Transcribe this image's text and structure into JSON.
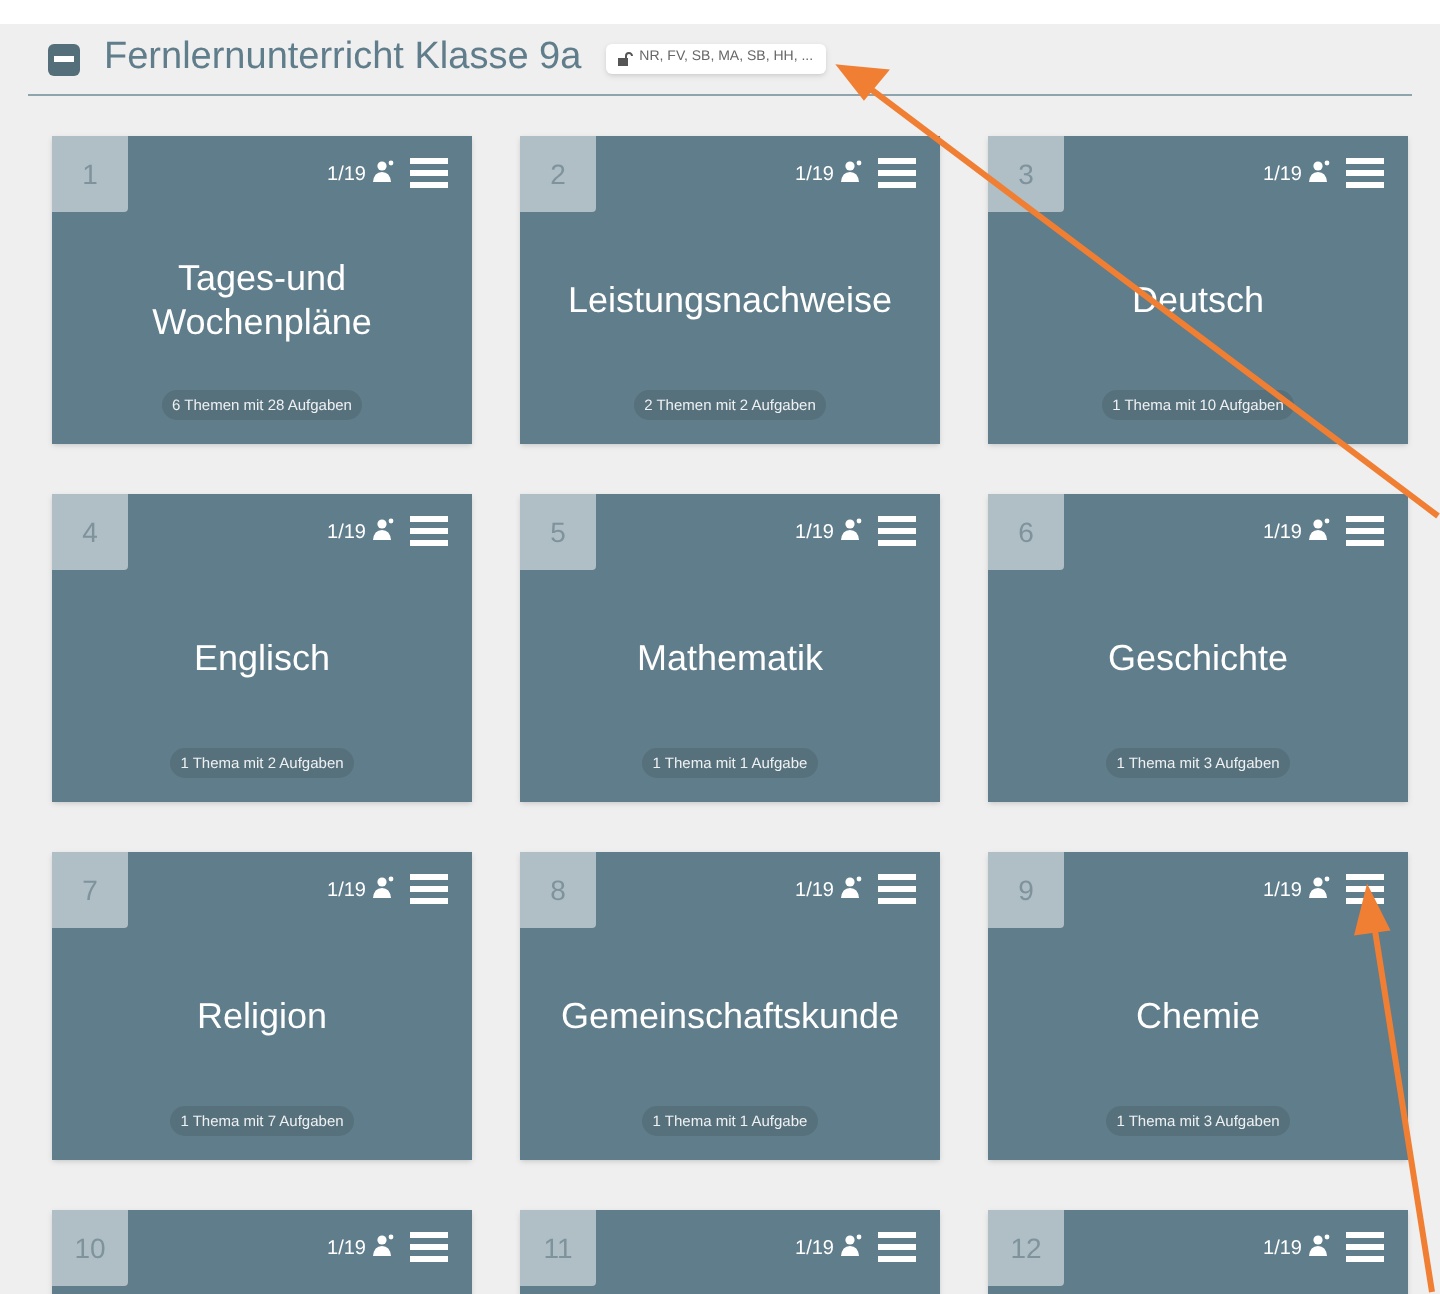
{
  "section": {
    "title": "Fernlernunterricht Klasse 9a",
    "expanded": true,
    "badge": "NR, FV, SB, MA, SB, HH, ..."
  },
  "cards": [
    {
      "number": "1",
      "count": "1/19",
      "title": "Tages-und Wochenpläne",
      "summary": "6 Themen mit 28 Aufgaben"
    },
    {
      "number": "2",
      "count": "1/19",
      "title": "Leistungsnachweise",
      "summary": "2 Themen mit 2 Aufgaben"
    },
    {
      "number": "3",
      "count": "1/19",
      "title": "Deutsch",
      "summary": "1 Thema mit 10 Aufgaben"
    },
    {
      "number": "4",
      "count": "1/19",
      "title": "Englisch",
      "summary": "1 Thema mit 2 Aufgaben"
    },
    {
      "number": "5",
      "count": "1/19",
      "title": "Mathematik",
      "summary": "1 Thema mit 1 Aufgabe"
    },
    {
      "number": "6",
      "count": "1/19",
      "title": "Geschichte",
      "summary": "1 Thema mit 3 Aufgaben"
    },
    {
      "number": "7",
      "count": "1/19",
      "title": "Religion",
      "summary": "1 Thema mit 7 Aufgaben"
    },
    {
      "number": "8",
      "count": "1/19",
      "title": "Gemeinschaftskunde",
      "summary": "1 Thema mit 1 Aufgabe"
    },
    {
      "number": "9",
      "count": "1/19",
      "title": "Chemie",
      "summary": "1 Thema mit 3 Aufgaben"
    },
    {
      "number": "10",
      "count": "1/19"
    },
    {
      "number": "11",
      "count": "1/19"
    },
    {
      "number": "12",
      "count": "1/19"
    }
  ]
}
